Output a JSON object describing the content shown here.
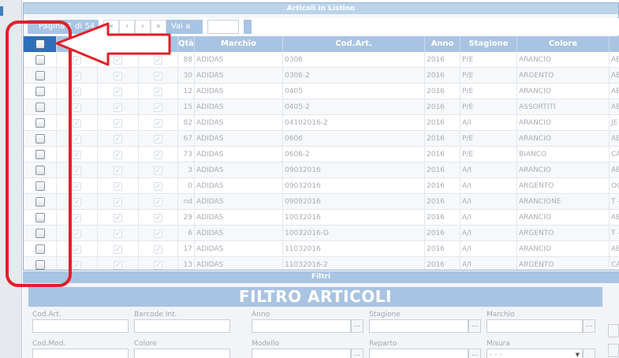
{
  "panel": {
    "title": "Articoli in Listino"
  },
  "pager": {
    "info": "Pagina 1 di 54",
    "first_icon": "«",
    "prev_icon": "‹",
    "next_icon": "›",
    "last_icon": "»",
    "goto_label": "Vai a",
    "page_value": ""
  },
  "grid": {
    "headers": {
      "qty": "Qtà",
      "brand": "Marchio",
      "code": "Cod.Art.",
      "year": "Anno",
      "season": "Stagione",
      "color": "Colore"
    },
    "rows": [
      {
        "qty": "88",
        "brand": "ADIDAS",
        "code": "0306",
        "year": "2016",
        "season": "P/E",
        "color": "ARANCIO",
        "extra": "AB"
      },
      {
        "qty": "30",
        "brand": "ADIDAS",
        "code": "0306-2",
        "year": "2016",
        "season": "P/E",
        "color": "ARGENTO",
        "extra": "AB"
      },
      {
        "qty": "12",
        "brand": "ADIDAS",
        "code": "0405",
        "year": "2016",
        "season": "P/E",
        "color": "ARANCIO",
        "extra": "AB"
      },
      {
        "qty": "15",
        "brand": "ADIDAS",
        "code": "0405-2",
        "year": "2016",
        "season": "P/E",
        "color": "ASSORTITI",
        "extra": "AB"
      },
      {
        "qty": "82",
        "brand": "ADIDAS",
        "code": "04102016-2",
        "year": "2016",
        "season": "A/I",
        "color": "ARANCIO",
        "extra": "JE"
      },
      {
        "qty": "67",
        "brand": "ADIDAS",
        "code": "0606",
        "year": "2016",
        "season": "P/E",
        "color": "ARANCIO",
        "extra": "AB"
      },
      {
        "qty": "73",
        "brand": "ADIDAS",
        "code": "0606-2",
        "year": "2016",
        "season": "P/E",
        "color": "BIANCO",
        "extra": "CA"
      },
      {
        "qty": "3",
        "brand": "ADIDAS",
        "code": "09032016",
        "year": "2016",
        "season": "A/I",
        "color": "ARANCIO",
        "extra": "AB"
      },
      {
        "qty": "0",
        "brand": "ADIDAS",
        "code": "09032016",
        "year": "2016",
        "season": "A/I",
        "color": "ARGENTO",
        "extra": "OC"
      },
      {
        "qty": "nd",
        "brand": "ADIDAS",
        "code": "09092016",
        "year": "2016",
        "season": "A/I",
        "color": "ARANCIONE",
        "extra": "T -"
      },
      {
        "qty": "29",
        "brand": "ADIDAS",
        "code": "10032016",
        "year": "2016",
        "season": "A/I",
        "color": "ARANCIO",
        "extra": "AB"
      },
      {
        "qty": "6",
        "brand": "ADIDAS",
        "code": "10032016-D",
        "year": "2016",
        "season": "A/I",
        "color": "ARGENTO",
        "extra": "T -"
      },
      {
        "qty": "17",
        "brand": "ADIDAS",
        "code": "11032016",
        "year": "2016",
        "season": "A/I",
        "color": "ARANCIO",
        "extra": "AB"
      },
      {
        "qty": "13",
        "brand": "ADIDAS",
        "code": "11032016-2",
        "year": "2016",
        "season": "A/I",
        "color": "ARGENTO",
        "extra": "CA"
      }
    ]
  },
  "filter": {
    "title": "Filtri",
    "banner": "FILTRO ARTICOLI",
    "labels": {
      "cod_art": "Cod.Art.",
      "barcode": "Barcode Int.",
      "anno": "Anno",
      "stagione": "Stagione",
      "marchio": "Marchio",
      "cod_mod": "Cod.Mod.",
      "colore": "Colore",
      "modello": "Modello",
      "reparto": "Reparto",
      "misura": "Misura"
    },
    "misura_value": "- - -",
    "lookup_label": "..."
  },
  "annotation": {
    "color": "#e0202a"
  },
  "icons": {
    "checkbox": "checkbox-icon",
    "check": "check-icon",
    "arrow": "arrow-left-icon"
  }
}
